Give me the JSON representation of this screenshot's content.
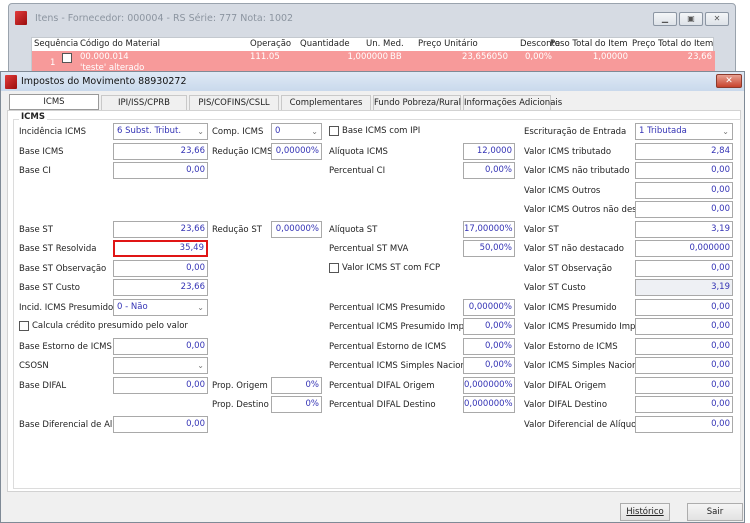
{
  "back_window": {
    "title": "Itens - Fornecedor: 000004 - RS Série: 777  Nota: 1002",
    "columns": [
      "Sequência",
      "Código do Material",
      "Operação",
      "Quantidade",
      "Un. Med.",
      "Preço Unitário",
      "Desconto",
      "Peso Total do Item",
      "Preço Total do Item"
    ],
    "row": {
      "sequencia": "1",
      "codigo": "00.000.014",
      "descricao": "'teste' alterado",
      "operacao": "111.05",
      "quantidade": "1,000000",
      "un_med": "BB",
      "preco_unitario": "23,656050",
      "desconto": "0,00%",
      "peso_total": "1,00000",
      "preco_total": "23,66"
    }
  },
  "dialog": {
    "title": "Impostos do Movimento 88930272",
    "tabs": [
      "ICMS",
      "IPI/ISS/CPRB",
      "PIS/COFINS/CSLL",
      "Complementares",
      "Fundo Pobreza/Rural",
      "Informações Adicionais"
    ],
    "active_tab": "ICMS",
    "group_label": "ICMS",
    "fields": [
      {
        "label": "Incidência ICMS",
        "type": "select",
        "value": "6 Subst. Tribut."
      },
      {
        "label": "Base ICMS",
        "type": "input",
        "value": "23,66"
      },
      {
        "label": "Base CI",
        "type": "input",
        "value": "0,00"
      },
      {
        "label": "Base ST",
        "type": "input",
        "value": "23,66"
      },
      {
        "label": "Base ST Resolvida",
        "type": "input",
        "value": "35,49",
        "highlight": true
      },
      {
        "label": "Base ST Observação",
        "type": "input",
        "value": "0,00"
      },
      {
        "label": "Base ST Custo",
        "type": "input",
        "value": "23,66"
      },
      {
        "label": "Incid. ICMS Presumido",
        "type": "select",
        "value": "0 - Não"
      },
      {
        "label": "Calcula crédito presumido pelo valor",
        "type": "checkbox",
        "checked": false
      },
      {
        "label": "Base Estorno de ICMS",
        "type": "input",
        "value": "0,00"
      },
      {
        "label": "CSOSN",
        "type": "select",
        "value": ""
      },
      {
        "label": "Base DIFAL",
        "type": "input",
        "value": "0,00"
      },
      {
        "label": "Base Diferencial de Alíq.",
        "type": "input",
        "value": "0,00"
      },
      {
        "label": "Comp. ICMS",
        "type": "select",
        "value": "0"
      },
      {
        "label": "Redução ICMS",
        "type": "input",
        "value": "0,00000%"
      },
      {
        "label": "Redução ST",
        "type": "input",
        "value": "0,00000%"
      },
      {
        "label": "Prop. Origem",
        "type": "input",
        "value": "0%"
      },
      {
        "label": "Prop. Destino",
        "type": "input",
        "value": "0%"
      },
      {
        "label": "Base ICMS com IPI",
        "type": "checkbox",
        "checked": false
      },
      {
        "label": "Alíquota ICMS",
        "type": "input",
        "value": "12,0000"
      },
      {
        "label": "Percentual CI",
        "type": "input",
        "value": "0,00%"
      },
      {
        "label": "Alíquota ST",
        "type": "input",
        "value": "17,00000%"
      },
      {
        "label": "Percentual ST MVA",
        "type": "input",
        "value": "50,00%"
      },
      {
        "label": "Valor ICMS ST com FCP",
        "type": "checkbox",
        "checked": false
      },
      {
        "label": "Percentual ICMS Presumido",
        "type": "input",
        "value": "0,00000%"
      },
      {
        "label": "Percentual ICMS Presumido Imp. PR",
        "type": "input",
        "value": "0,00%"
      },
      {
        "label": "Percentual Estorno de ICMS",
        "type": "input",
        "value": "0,00%"
      },
      {
        "label": "Percentual ICMS Simples Nacional",
        "type": "input",
        "value": "0,00%"
      },
      {
        "label": "Percentual DIFAL Origem",
        "type": "input",
        "value": "0,000000%"
      },
      {
        "label": "Percentual DIFAL Destino",
        "type": "input",
        "value": "0,000000%"
      },
      {
        "label": "Escrituração de Entrada",
        "type": "select",
        "value": "1 Tributada"
      },
      {
        "label": "Valor ICMS tributado",
        "type": "input",
        "value": "2,84"
      },
      {
        "label": "Valor ICMS não tributado",
        "type": "input",
        "value": "0,00"
      },
      {
        "label": "Valor ICMS Outros",
        "type": "input",
        "value": "0,00"
      },
      {
        "label": "Valor ICMS Outros não dest.",
        "type": "input",
        "value": "0,00"
      },
      {
        "label": "Valor ST",
        "type": "input",
        "value": "3,19"
      },
      {
        "label": "Valor ST não destacado",
        "type": "input",
        "value": "0,000000"
      },
      {
        "label": "Valor ST Observação",
        "type": "input",
        "value": "0,00"
      },
      {
        "label": "Valor ST Custo",
        "type": "input",
        "value": "3,19",
        "readonly": true
      },
      {
        "label": "Valor ICMS Presumido",
        "type": "input",
        "value": "0,00"
      },
      {
        "label": "Valor ICMS Presumido Imp. PR",
        "type": "input",
        "value": "0,00"
      },
      {
        "label": "Valor Estorno de ICMS",
        "type": "input",
        "value": "0,00"
      },
      {
        "label": "Valor ICMS Simples Nacional",
        "type": "input",
        "value": "0,00"
      },
      {
        "label": "Valor DIFAL Origem",
        "type": "input",
        "value": "0,00"
      },
      {
        "label": "Valor DIFAL Destino",
        "type": "input",
        "value": "0,00"
      },
      {
        "label": "Valor Diferencial de Alíquota",
        "type": "input",
        "value": "0,00"
      }
    ],
    "buttons": {
      "historico": "Histórico",
      "sair": "Sair"
    }
  },
  "colors": {
    "highlight_border": "#e01515",
    "value_text": "#3433b5",
    "row_selected": "#f79a9a"
  }
}
